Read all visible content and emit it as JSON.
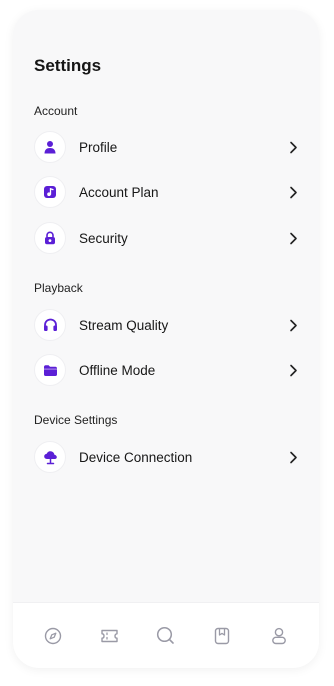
{
  "header": {
    "title": "Settings"
  },
  "sections": {
    "account": {
      "label": "Account",
      "items": [
        {
          "label": "Profile",
          "icon": "user-icon"
        },
        {
          "label": "Account Plan",
          "icon": "music-note-icon"
        },
        {
          "label": "Security",
          "icon": "lock-icon"
        }
      ]
    },
    "playback": {
      "label": "Playback",
      "items": [
        {
          "label": "Stream Quality",
          "icon": "headphones-icon"
        },
        {
          "label": "Offline Mode",
          "icon": "folder-icon"
        }
      ]
    },
    "device": {
      "label": "Device Settings",
      "items": [
        {
          "label": "Device Connection",
          "icon": "cloud-connection-icon"
        }
      ]
    }
  },
  "tabbar": {
    "items": [
      "compass-icon",
      "ticket-icon",
      "search-icon",
      "bookmark-icon",
      "user-icon"
    ]
  },
  "colors": {
    "accent": "#5b1fd6",
    "icon_inactive": "#9a9aa6",
    "background": "#f8f8f9"
  }
}
